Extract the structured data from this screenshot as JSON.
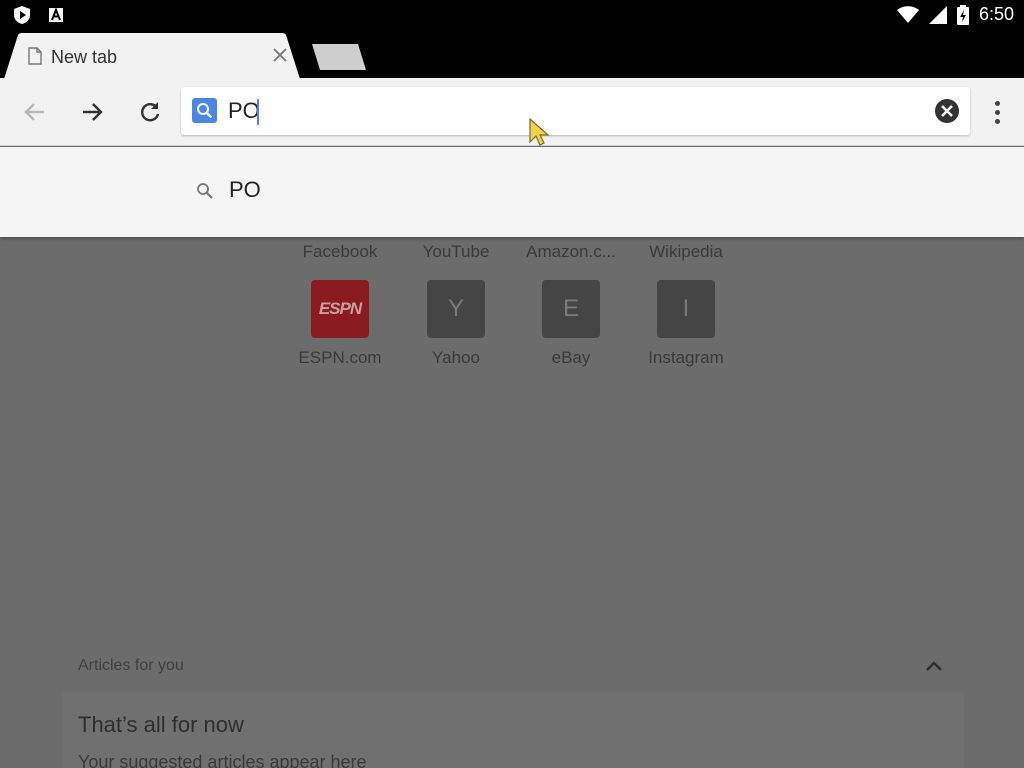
{
  "status_bar": {
    "time": "6:50",
    "icons": [
      "shield-play-icon",
      "a-box-icon",
      "wifi-icon",
      "signal-icon",
      "battery-charging-icon"
    ]
  },
  "tabs": {
    "active": {
      "title": "New tab",
      "icon": "document-icon",
      "close_icon": "close-icon"
    },
    "new_tab_icon": "new-tab-icon"
  },
  "toolbar": {
    "back_icon": "arrow-left-icon",
    "forward_icon": "arrow-right-icon",
    "reload_icon": "reload-icon",
    "omnibox": {
      "value": "PO",
      "search_icon": "search-icon",
      "clear_icon": "clear-icon"
    },
    "menu_icon": "more-vert-icon"
  },
  "suggestions": [
    {
      "icon": "search-icon",
      "text": "PO"
    }
  ],
  "most_visited": {
    "row1": [
      {
        "label": "Facebook"
      },
      {
        "label": "YouTube"
      },
      {
        "label": "Amazon.c..."
      },
      {
        "label": "Wikipedia"
      }
    ],
    "row2": [
      {
        "label": "ESPN.com",
        "icon_text": "ESPN"
      },
      {
        "label": "Yahoo",
        "icon_text": "Y"
      },
      {
        "label": "eBay",
        "icon_text": "E"
      },
      {
        "label": "Instagram",
        "icon_text": "I"
      }
    ]
  },
  "articles": {
    "header": "Articles for you",
    "card_title": "That’s all for now",
    "card_subtitle": "Your suggested articles appear here"
  },
  "colors": {
    "accent": "#4a86e8",
    "overlay": "#6c6c6c",
    "toolbar": "#f2f2f2",
    "espn": "#8a1c21"
  }
}
